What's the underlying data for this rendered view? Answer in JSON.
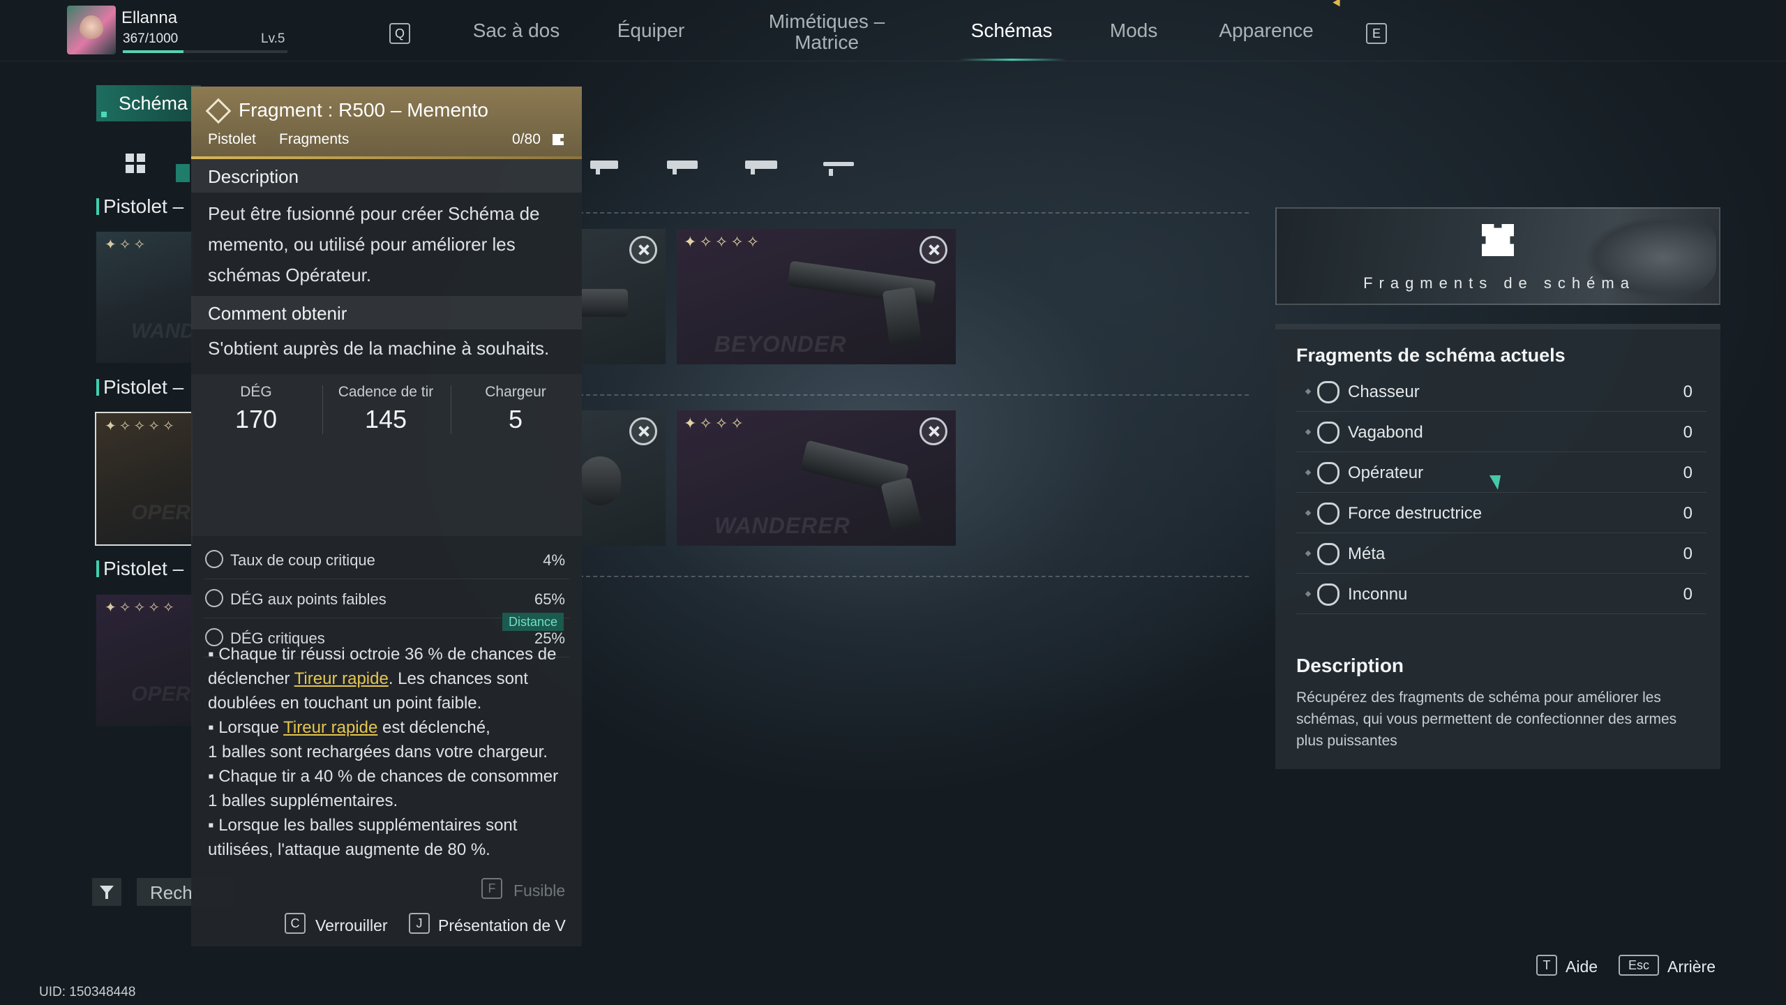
{
  "player": {
    "name": "Ellanna",
    "xp_text": "367/1000",
    "xp_fraction": 0.367,
    "level": "Lv.5"
  },
  "nav": {
    "key_left": "Q",
    "key_right": "E",
    "tabs": [
      {
        "label": "Sac à dos"
      },
      {
        "label": "Équiper"
      },
      {
        "label": "Mimétiques –\nMatrice"
      },
      {
        "label": "Schémas",
        "active": true
      },
      {
        "label": "Mods"
      },
      {
        "label": "Apparence"
      }
    ]
  },
  "left": {
    "tab_label": "Schéma",
    "categories": [
      "Pistolet –",
      "Pistolet –",
      "Pistolet –"
    ],
    "cards": [
      {
        "stars": "✦✧✧",
        "watermark": "WANDE"
      },
      {
        "stars": "✦✧✧✧✧",
        "watermark": "OPERA"
      },
      {
        "stars": "✦✧✧✧✧",
        "watermark": "OPERA"
      }
    ],
    "search_label": "Rech",
    "uid": "UID: 150348448"
  },
  "weapons": [
    {
      "stars": "",
      "watermark": ""
    },
    {
      "stars": "✦✧✧✧✧",
      "watermark": "BEYONDER"
    },
    {
      "stars": "",
      "watermark": ""
    },
    {
      "stars": "✦✧✧✧",
      "watermark": "WANDERER"
    }
  ],
  "tooltip": {
    "title": "Fragment : R500 – Memento",
    "tag_type": "Pistolet",
    "tag_category": "Fragments",
    "count": "0/80",
    "section_desc": "Description",
    "description": "Peut être fusionné pour créer Schéma de memento, ou utilisé pour améliorer les schémas Opérateur.",
    "section_obtain": "Comment obtenir",
    "obtain": "S'obtient auprès de la machine à souhaits.",
    "stats": [
      {
        "label": "DÉG",
        "value": "170"
      },
      {
        "label": "Cadence de tir",
        "value": "145"
      },
      {
        "label": "Chargeur",
        "value": "5"
      }
    ],
    "substats": [
      {
        "icon": "crit-rate-icon",
        "name": "Taux de coup critique",
        "value": "4%"
      },
      {
        "icon": "weakspot-icon",
        "name": "DÉG aux points faibles",
        "value": "65%"
      },
      {
        "icon": "crit-dmg-icon",
        "name": "DÉG critiques",
        "value": "25%"
      }
    ],
    "badge": "Distance",
    "effects": {
      "e1a": "Chaque tir réussi octroie 36 % de chances de déclencher ",
      "e1link": "Tireur rapide",
      "e1b": ". Les chances sont doublées en touchant un point faible.",
      "e2a": "Lorsque ",
      "e2link": "Tireur rapide",
      "e2b": " est déclenché,",
      "e2c": "1 balles sont rechargées dans votre chargeur.",
      "e3": "Chaque tir a 40 % de chances de consommer 1 balles supplémentaires.",
      "e4": "Lorsque les balles supplémentaires sont utilisées, l'attaque augmente de 80 %."
    },
    "fuse_key": "F",
    "fuse_label": "Fusible",
    "lock_key": "C",
    "lock_label": "Verrouiller",
    "view_key": "J",
    "view_label": "Présentation de V"
  },
  "right": {
    "banner_title": "Fragments de schéma",
    "panel_title": "Fragments de schéma actuels",
    "rows": [
      {
        "name": "Chasseur",
        "value": "0"
      },
      {
        "name": "Vagabond",
        "value": "0"
      },
      {
        "name": "Opérateur",
        "value": "0"
      },
      {
        "name": "Force destructrice",
        "value": "0"
      },
      {
        "name": "Méta",
        "value": "0"
      },
      {
        "name": "Inconnu",
        "value": "0"
      }
    ],
    "desc_title": "Description",
    "desc": "Récupérez des fragments de schéma pour améliorer les schémas, qui vous permettent de confectionner des armes plus puissantes"
  },
  "hints": {
    "help_key": "T",
    "help_label": "Aide",
    "back_key": "Esc",
    "back_label": "Arrière"
  },
  "colors": {
    "accent": "#49c7a9",
    "gold": "#d7b659",
    "link": "#e6c64e"
  }
}
